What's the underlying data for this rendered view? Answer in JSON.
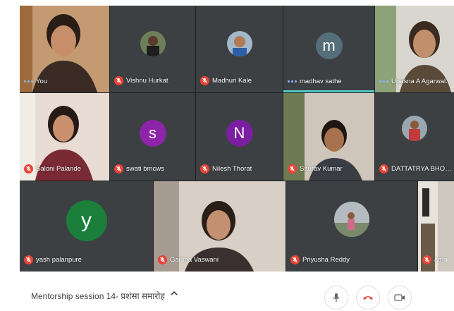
{
  "participants": {
    "you": "You",
    "vishnu": "Vishnu Hurkat",
    "madhuri": "Madhuri Kale",
    "madhav": "madhav sathe",
    "madhav_initial": "m",
    "upasna": "Upasna A Agarwal.",
    "saloni": "Saloni Palande",
    "swati": "swati bmcws",
    "swati_initial": "s",
    "nilesh": "Nilesh Thorat",
    "nilesh_initial": "N",
    "saurav": "Saurav Kumar",
    "dattatrya": "DATTATRYA BHOKSE",
    "yash": "yash palanpure",
    "yash_initial": "y",
    "garima": "Garima Vaswani",
    "priyusha": "Priyusha Reddy",
    "partial_last": "ama"
  },
  "colors": {
    "grid_bg": "#202124",
    "tile_bg": "#3c4043",
    "mute_red": "#ea4335",
    "avatar_m": "#546e7a",
    "avatar_s": "#8e24aa",
    "avatar_n": "#7b1fa2",
    "avatar_y": "#1b7f3b",
    "speaking_highlight": "#56c7c6"
  },
  "footer": {
    "meeting_title": "Mentorship session 14- प्रशंसा समारोह"
  },
  "icons": {
    "mute": "mic-off-icon",
    "mic": "mic-icon",
    "hangup": "phone-hangup-icon",
    "camera": "camera-icon",
    "chevron": "chevron-up-icon",
    "dots": "speaking-dots-icon"
  }
}
